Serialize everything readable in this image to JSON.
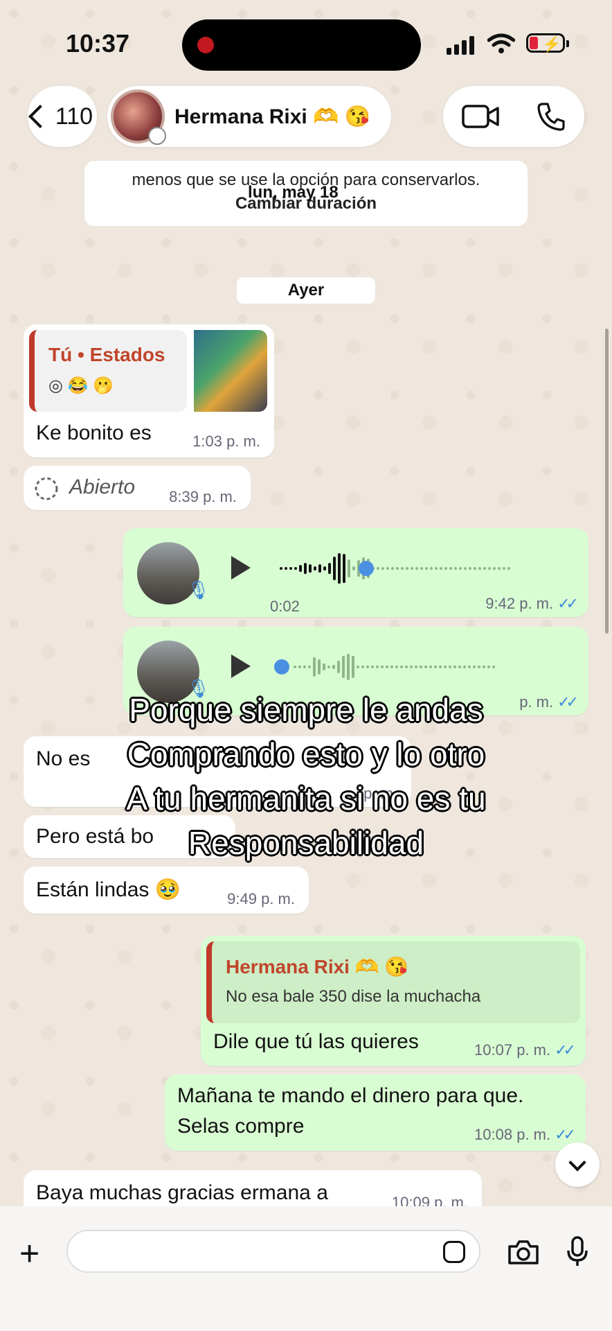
{
  "status": {
    "time": "10:37"
  },
  "header": {
    "back_count": "110",
    "contact_name": "Hermana Rixi 🫶 😘"
  },
  "system_card": {
    "line1": "menos que se use la opción para conservarlos.",
    "line2": "Cambiar duración",
    "floating_date": "lun, may 18"
  },
  "day_chip": "Ayer",
  "messages": [
    {
      "quote_title": "Tú • Estados",
      "quote_sub": "◎ 😂 🫢",
      "text": "Ke bonito es",
      "time": "1:03 p. m."
    },
    {
      "text": "Abierto",
      "time": "8:39 p. m."
    },
    {
      "duration": "0:02",
      "time": "9:42 p. m."
    },
    {
      "time": "p. m."
    },
    {
      "text": "No es",
      "time": "p. m."
    },
    {
      "text": "Pero está bo",
      "time": ""
    },
    {
      "text": "Están lindas 🥹",
      "time": "9:49 p. m."
    },
    {
      "quote_title": "Hermana Rixi 🫶 😘",
      "quote_sub": "No esa bale 350 dise la muchacha",
      "text": "Dile que tú las quieres",
      "time": "10:07 p. m."
    },
    {
      "text_line1": "Mañana te mando el dinero para que.",
      "text_line2": "Selas compre",
      "time": "10:08 p. m."
    },
    {
      "text": "Baya muchas gracias ermana a",
      "time": "10:09 p. m."
    }
  ],
  "overlay_text": [
    "Porque siempre le andas",
    "Comprando esto y lo otro",
    "A tu hermanita si no es tu",
    "Responsabilidad"
  ],
  "colors": {
    "outgoing": "#d9fdd3",
    "incoming": "#ffffff",
    "ticks": "#3d8bd9",
    "quote_accent": "#c0392b"
  }
}
